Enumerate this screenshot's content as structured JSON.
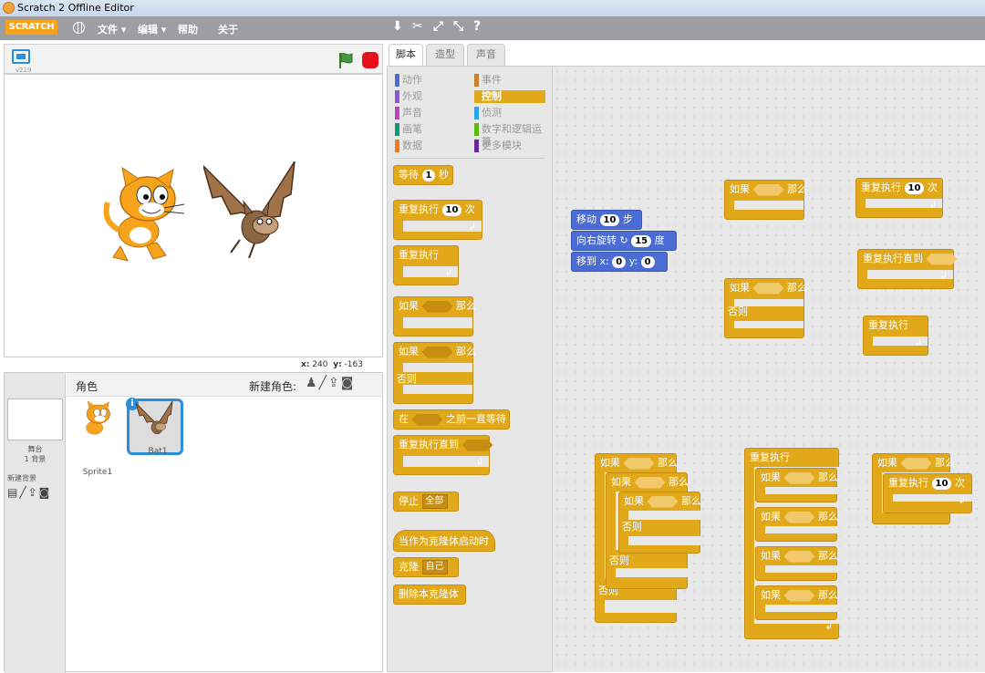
{
  "window": {
    "title": "Scratch 2 Offline Editor"
  },
  "menubar": {
    "logo": "SCRATCH",
    "file": "文件 ▾",
    "edit": "编辑 ▾",
    "help": "帮助",
    "about": "关于"
  },
  "stage": {
    "version": "v219",
    "coords_x_label": "x:",
    "coords_x": "240",
    "coords_y_label": "y:",
    "coords_y": "-163"
  },
  "sprites": {
    "title": "角色",
    "new_sprite": "新建角色:",
    "stage_label_1": "舞台",
    "stage_label_2": "1 背景",
    "new_backdrop": "新建背景",
    "items": [
      {
        "name": "Sprite1"
      },
      {
        "name": "Bat1"
      }
    ]
  },
  "tabs": [
    {
      "label": "脚本"
    },
    {
      "label": "造型"
    },
    {
      "label": "声音"
    }
  ],
  "categories": [
    {
      "label": "动作",
      "color": "#4a6cd4"
    },
    {
      "label": "外观",
      "color": "#8a55d7"
    },
    {
      "label": "声音",
      "color": "#bb42c3"
    },
    {
      "label": "画笔",
      "color": "#0e9a6c"
    },
    {
      "label": "数据",
      "color": "#ee7d16"
    },
    {
      "label": "事件",
      "color": "#c88330"
    },
    {
      "label": "控制",
      "color": "#e1a91a"
    },
    {
      "label": "侦测",
      "color": "#2ca5e2"
    },
    {
      "label": "数字和逻辑运算",
      "color": "#5cb712"
    },
    {
      "label": "更多模块",
      "color": "#632d99"
    }
  ],
  "palette_blocks": {
    "wait_text": "等待",
    "wait_val": "1",
    "wait_unit": "秒",
    "repeat_text": "重复执行",
    "repeat_val": "10",
    "repeat_unit": "次",
    "forever": "重复执行",
    "if_text": "如果",
    "then_text": "那么",
    "else_text": "否则",
    "wait_until_pre": "在",
    "wait_until_post": "之前一直等待",
    "repeat_until": "重复执行直到",
    "stop_text": "停止",
    "stop_val": "全部",
    "clone_start": "当作为克隆体启动时",
    "clone_text": "克隆",
    "clone_val": "自己",
    "delete_clone": "删除本克隆体"
  },
  "motion_script": {
    "move": "移动",
    "move_val": "10",
    "move_unit": "步",
    "turn": "向右旋转",
    "turn_val": "15",
    "turn_unit": "度",
    "goto": "移到 x:",
    "goto_x": "0",
    "goto_y_label": "y:",
    "goto_y": "0"
  },
  "colors": {
    "control": "#e1a91a",
    "motion": "#4a6cd4",
    "accent": "#2a8fd8"
  }
}
